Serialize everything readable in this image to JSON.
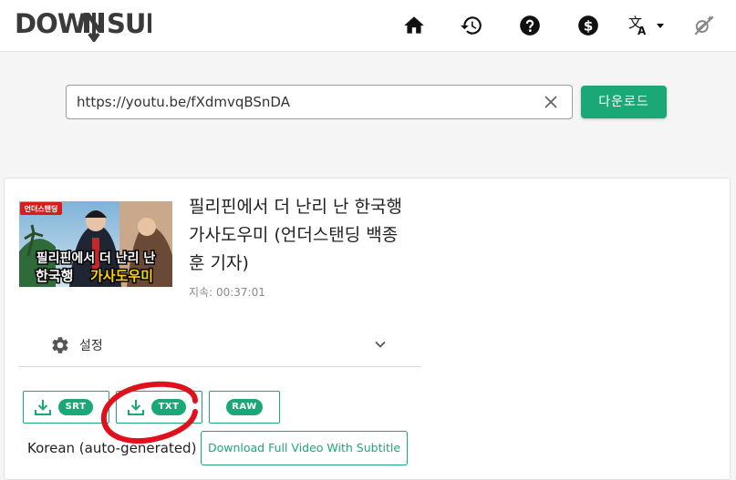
{
  "header": {
    "logo_text": "DOWNSUB",
    "nav_icons": [
      "home-icon",
      "history-icon",
      "help-icon",
      "dollar-icon",
      "translate-icon",
      "theme-toggle-icon"
    ]
  },
  "search": {
    "url_value": "https://youtu.be/fXdmvqBSnDA",
    "download_label": "다운로드"
  },
  "video": {
    "title": "필리핀에서 더 난리 난 한국행 가사도우미 (언더스탠딩 백종훈 기자)",
    "duration": "지속: 00:37:01",
    "thumbnail": {
      "badge": "언더스탠딩",
      "caption_line1": "필리핀에서 더 난리 난",
      "caption_line2_a": "한국행",
      "caption_line2_b": "가사도우미"
    }
  },
  "settings": {
    "label": "설정"
  },
  "subtitle": {
    "formats": [
      "SRT",
      "TXT",
      "RAW"
    ],
    "language": "Korean (auto-generated)",
    "full_video_label": "Download Full Video With Subtitle"
  },
  "colors": {
    "accent": "#1aa877",
    "annotation": "#e0101c"
  }
}
